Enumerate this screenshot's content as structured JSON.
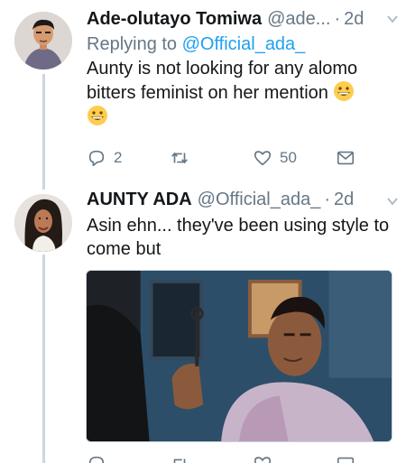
{
  "tweets": [
    {
      "display_name": "Ade-olutayo Tomiwa",
      "handle": "@ade...",
      "separator": "·",
      "time": "2d",
      "reply_prefix": "Replying to",
      "reply_to": "@Official_ada_",
      "text": "Aunty is not looking for any alomo bitters feminist on her mention",
      "emojis": [
        "grinning-face",
        "grinning-face"
      ],
      "actions": {
        "reply_count": "2",
        "retweet_count": "",
        "like_count": "50"
      }
    },
    {
      "display_name": "AUNTY ADA",
      "handle": "@Official_ada_",
      "separator": "·",
      "time": "2d",
      "text": "Asin ehn... they've been using style to come but",
      "media": "image-man-with-key"
    }
  ],
  "icons": {
    "reply": "reply-icon",
    "retweet": "retweet-icon",
    "like": "heart-icon",
    "dm": "envelope-icon",
    "caret": "chevron-down-icon"
  },
  "colors": {
    "link": "#1da1f2",
    "muted": "#657786",
    "text": "#14171a",
    "thread": "#ccd6dd"
  }
}
